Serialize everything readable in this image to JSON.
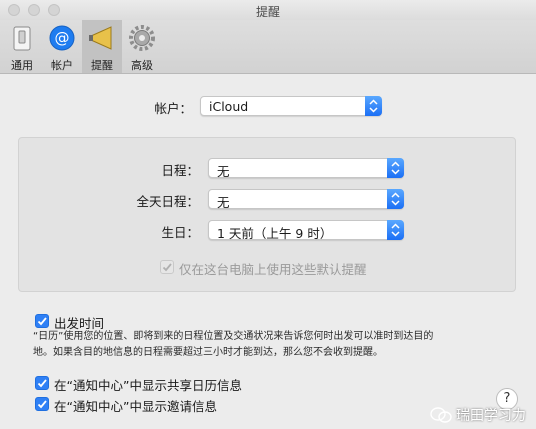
{
  "window": {
    "title": "提醒"
  },
  "toolbar": {
    "items": [
      {
        "label": "通用",
        "icon": "switch-icon"
      },
      {
        "label": "帐户",
        "icon": "at-sign-icon"
      },
      {
        "label": "提醒",
        "icon": "megaphone-icon",
        "selected": true
      },
      {
        "label": "高级",
        "icon": "gear-icon"
      }
    ]
  },
  "account": {
    "label": "帐户：",
    "value": "iCloud"
  },
  "defaults": {
    "rows": [
      {
        "label": "日程：",
        "value": "无"
      },
      {
        "label": "全天日程：",
        "value": "无"
      },
      {
        "label": "生日：",
        "value": "1 天前（上午 9 时）"
      }
    ],
    "this_computer_only": {
      "label": "仅在这台电脑上使用这些默认提醒",
      "checked": true,
      "enabled": false
    }
  },
  "leave_time": {
    "label": "出发时间",
    "checked": true,
    "description_line1": "“日历”使用您的位置、即将到来的日程位置及交通状况来告诉您何时出发可以准时到达目的",
    "description_line2": "地。如果含目的地信息的日程需要超过三小时才能到达，那么您不会收到提醒。"
  },
  "notification_center": [
    {
      "label": "在“通知中心”中显示共享日历信息",
      "checked": true
    },
    {
      "label": "在“通知中心”中显示邀请信息",
      "checked": true
    }
  ],
  "help_button": {
    "label": "?"
  },
  "watermark": {
    "text": "瑞田学习力",
    "icon": "wechat-icon"
  },
  "colors": {
    "accent": "#2f80f5",
    "toolbar_selected": "#c2c2c2",
    "background": "#ececec"
  }
}
